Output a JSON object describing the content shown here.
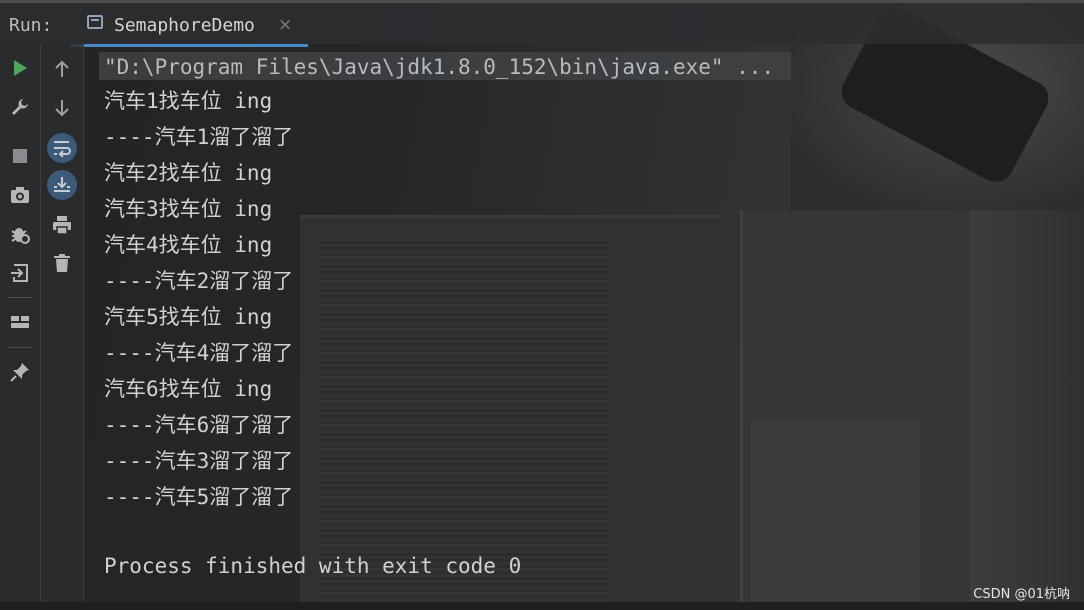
{
  "header": {
    "run_label": "Run:",
    "tab_label": "SemaphoreDemo",
    "tab_close": "×"
  },
  "toolbar_left": {
    "icons": [
      "run-icon",
      "wrench-icon",
      "stop-icon",
      "camera-icon",
      "bug-icon",
      "login-icon",
      "layout-icon",
      "pin-icon"
    ]
  },
  "toolbar_right": {
    "icons": [
      "arrow-up-icon",
      "arrow-down-icon",
      "soft-wrap-icon",
      "scroll-to-end-icon",
      "print-icon",
      "trash-icon"
    ]
  },
  "console": {
    "command": "\"D:\\Program Files\\Java\\jdk1.8.0_152\\bin\\java.exe\" ...",
    "lines": [
      "汽车1找车位 ing",
      "----汽车1溜了溜了",
      "汽车2找车位 ing",
      "汽车3找车位 ing",
      "汽车4找车位 ing",
      "----汽车2溜了溜了",
      "汽车5找车位 ing",
      "----汽车4溜了溜了",
      "汽车6找车位 ing",
      "----汽车6溜了溜了",
      "----汽车3溜了溜了",
      "----汽车5溜了溜了"
    ],
    "exit_message": "Process finished with exit code 0"
  },
  "watermark": "CSDN @01杭呐",
  "colors": {
    "run_green": "#4fa65a",
    "accent_blue": "#4a88c7",
    "text": "#cfd2d4"
  }
}
